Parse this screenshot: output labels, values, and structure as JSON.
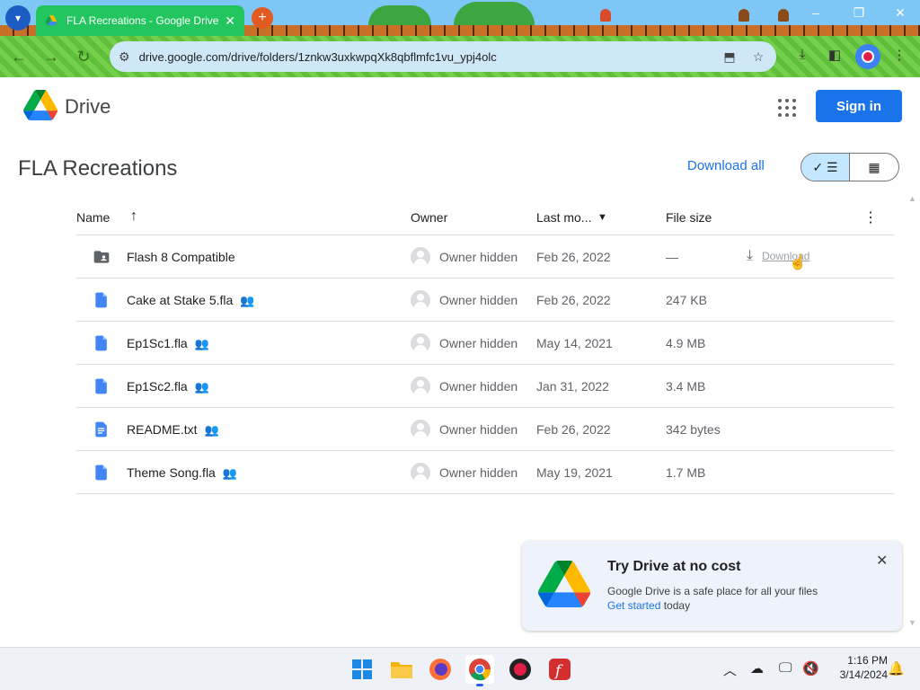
{
  "browser": {
    "tab_title": "FLA Recreations - Google Drive",
    "tab_close": "✕",
    "new_tab": "+",
    "url": "drive.google.com/drive/folders/1znkw3uxkwpqXk8qbflmfc1vu_ypj4olc",
    "window_controls": [
      "–",
      "❐",
      "✕"
    ]
  },
  "drive": {
    "brand": "Drive",
    "sign_in": "Sign in",
    "folder_title": "FLA Recreations",
    "download_all": "Download all",
    "columns": {
      "name": "Name",
      "owner": "Owner",
      "last_modified": "Last mo...",
      "file_size": "File size"
    },
    "files": [
      {
        "name": "Flash 8 Compatible",
        "type": "folder",
        "shared": false,
        "owner": "Owner hidden",
        "date": "Feb 26, 2022",
        "size": "—",
        "download": "Download"
      },
      {
        "name": "Cake at Stake 5.fla",
        "type": "file",
        "shared": true,
        "owner": "Owner hidden",
        "date": "Feb 26, 2022",
        "size": "247 KB"
      },
      {
        "name": "Ep1Sc1.fla",
        "type": "file",
        "shared": true,
        "owner": "Owner hidden",
        "date": "May 14, 2021",
        "size": "4.9 MB"
      },
      {
        "name": "Ep1Sc2.fla",
        "type": "file",
        "shared": true,
        "owner": "Owner hidden",
        "date": "Jan 31, 2022",
        "size": "3.4 MB"
      },
      {
        "name": "README.txt",
        "type": "doc",
        "shared": true,
        "owner": "Owner hidden",
        "date": "Feb 26, 2022",
        "size": "342 bytes"
      },
      {
        "name": "Theme Song.fla",
        "type": "file",
        "shared": true,
        "owner": "Owner hidden",
        "date": "May 19, 2021",
        "size": "1.7 MB"
      }
    ],
    "promo": {
      "title": "Try Drive at no cost",
      "description": "Google Drive is a safe place for all your files",
      "link": "Get started",
      "after_link": " today"
    }
  },
  "taskbar": {
    "time": "1:16 PM",
    "date": "3/14/2024"
  },
  "colors": {
    "accent": "#1a73e8",
    "tab": "#22c55e",
    "toolbar": "#6cc943"
  }
}
